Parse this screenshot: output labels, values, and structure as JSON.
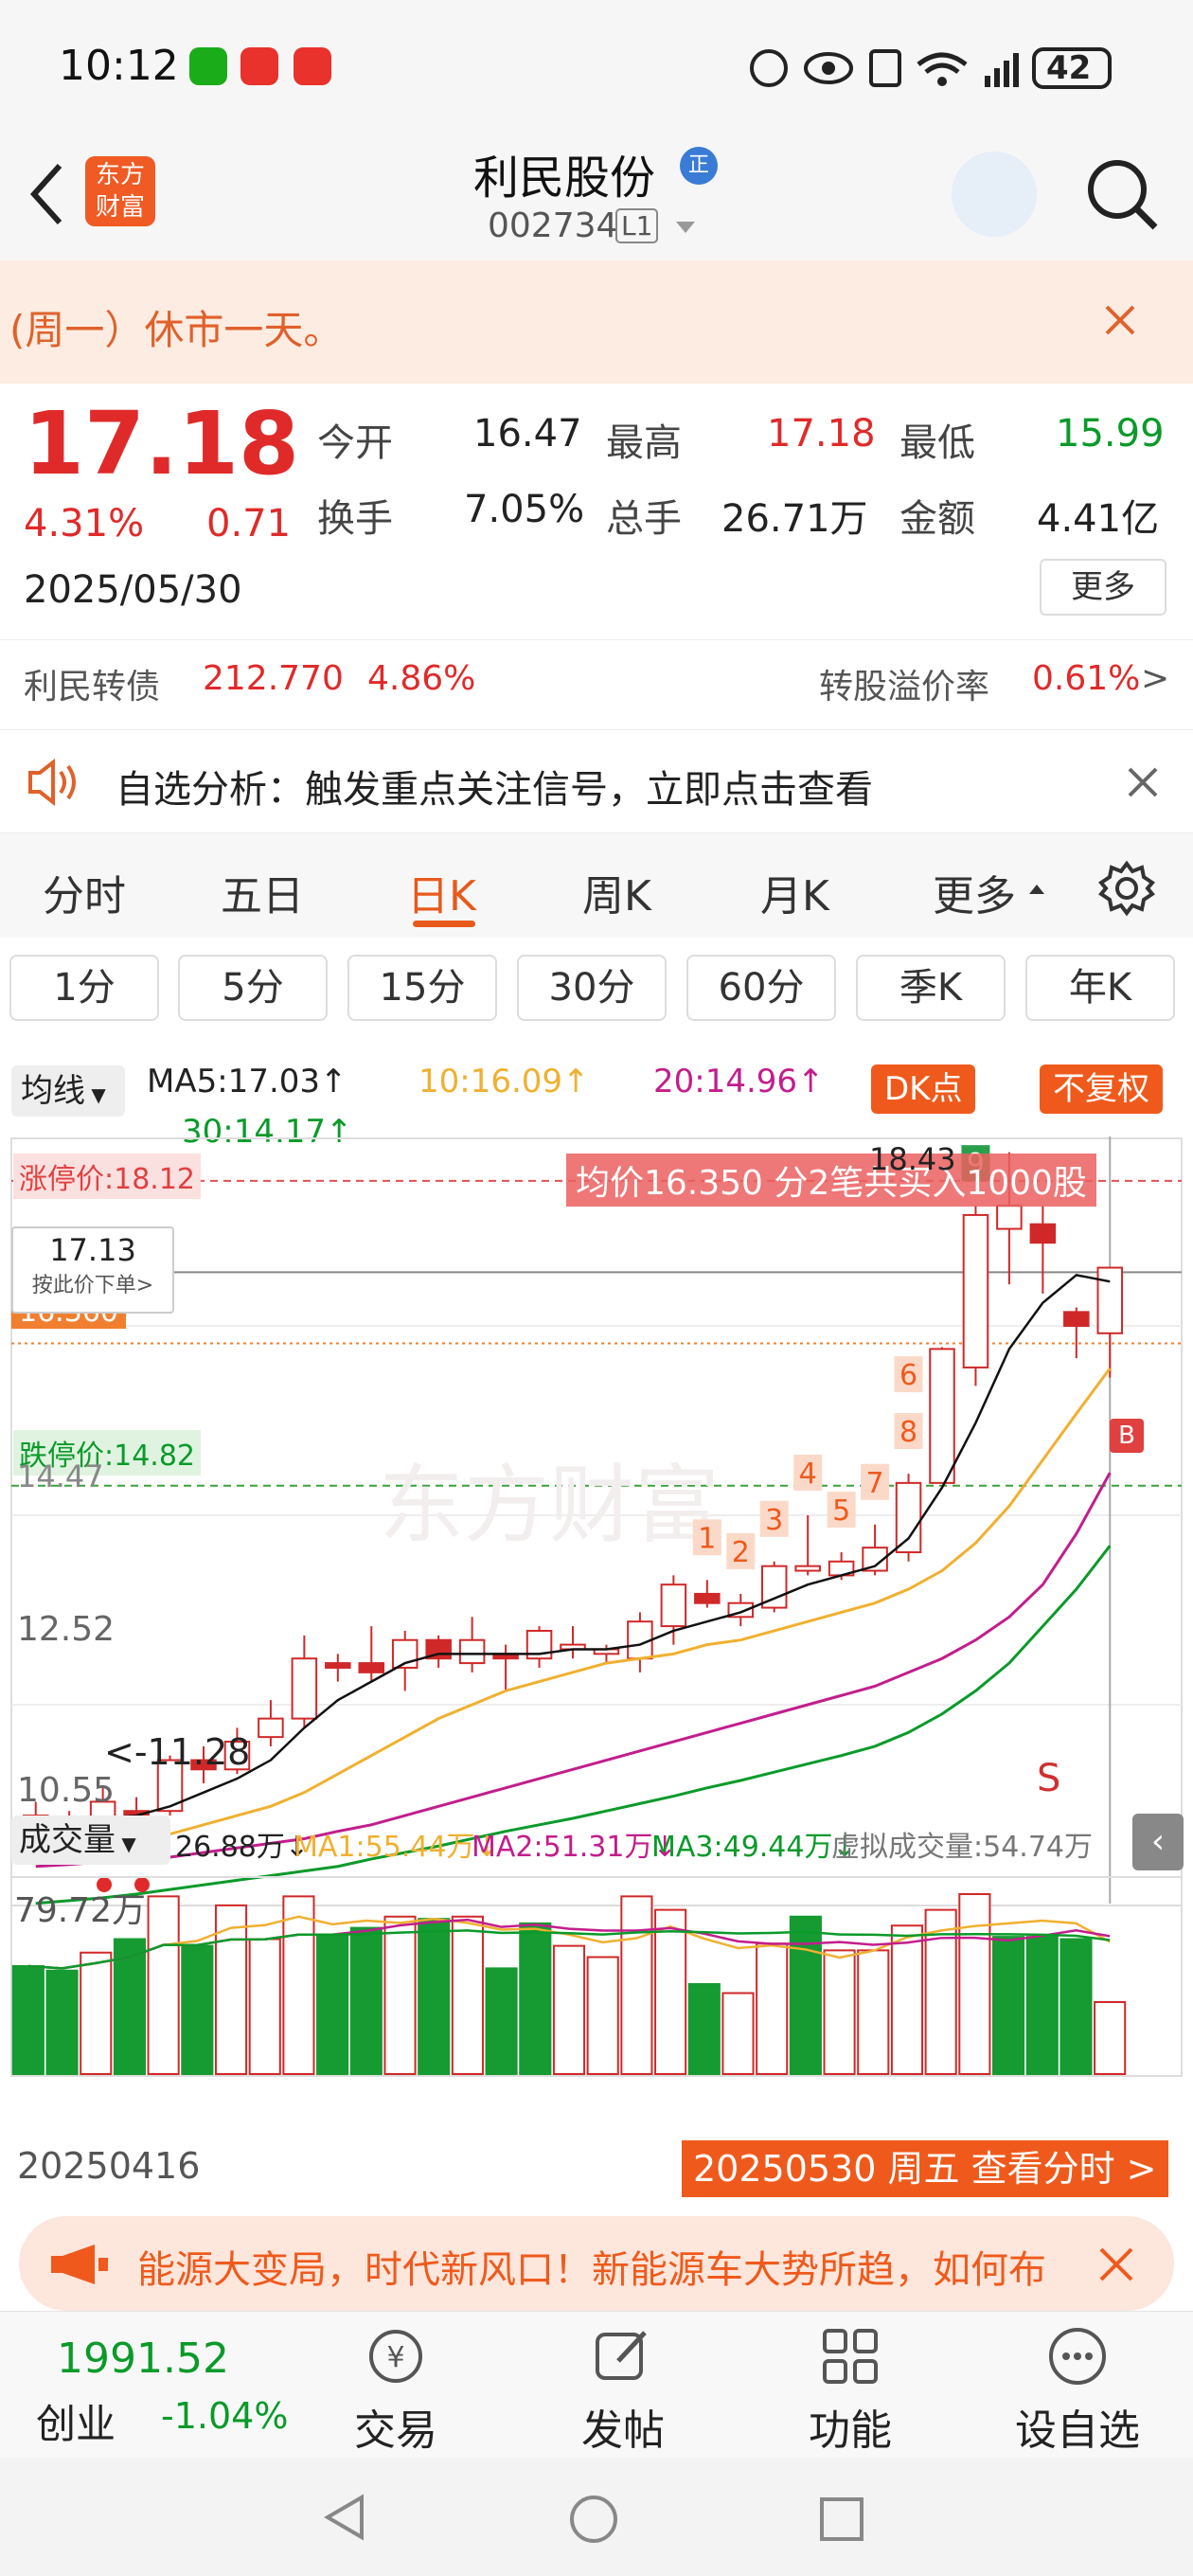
{
  "status_bar": {
    "time": "10:12",
    "battery": "42"
  },
  "header": {
    "title": "利民股份",
    "title_badge": "正",
    "code": "002734",
    "level": "L1",
    "logo_line1": "东方",
    "logo_line2": "财富"
  },
  "notice": {
    "text": "(周一）休市一天。"
  },
  "quote": {
    "price": "17.18",
    "change_pct": "4.31%",
    "change": "0.71",
    "date": "2025/05/30",
    "fields": [
      {
        "label": "今开",
        "value": "16.47"
      },
      {
        "label": "最高",
        "value": "17.18"
      },
      {
        "label": "最低",
        "value": "15.99"
      },
      {
        "label": "换手",
        "value": "7.05%"
      },
      {
        "label": "总手",
        "value": "26.71万"
      },
      {
        "label": "金额",
        "value": "4.41亿"
      }
    ],
    "more_label": "更多"
  },
  "convertible": {
    "name": "利民转债",
    "price": "212.770",
    "pct": "4.86%",
    "premium_label": "转股溢价率",
    "premium_value": "0.61%",
    "arrow": ">"
  },
  "signal": {
    "text": "自选分析：触发重点关注信号，立即点击查看"
  },
  "tabs": [
    "分时",
    "五日",
    "日K",
    "周K",
    "月K",
    "更多"
  ],
  "active_tab": "日K",
  "periods": [
    "1分",
    "5分",
    "15分",
    "30分",
    "60分",
    "季K",
    "年K"
  ],
  "ma_bar": {
    "selector": "均线",
    "ma5": "MA5:17.03↑",
    "ma10": "10:16.09↑",
    "ma20": "20:14.96↑",
    "ma30": "30:14.17↑",
    "dk_label": "DK点",
    "fq_label": "不复权"
  },
  "price_chart": {
    "limit_up_label": "涨停价:18.12",
    "limit_down_label": "跌停价:14.82",
    "high_label": "18.43",
    "low_label": "<-11.28",
    "avg_text": "均价16.350  分2笔共买入1000股",
    "cursor_price": "17.13",
    "cursor_hint": "按此价下单>",
    "left_tag": "16.360",
    "y_mid1": "14.47",
    "y_mid2": "12.52",
    "y_low": "10.55",
    "nums": [
      "1",
      "2",
      "3",
      "4",
      "5",
      "6",
      "7",
      "8",
      "9"
    ],
    "sell_marker": "S",
    "buy_marker": "B",
    "watermark": "东方财富"
  },
  "volume": {
    "selector": "成交量",
    "vol": "26.88万↓",
    "ma1": "MA1:55.44万↓",
    "ma2": "MA2:51.31万↓",
    "ma3": "MA3:49.44万↓",
    "virtual": "虚拟成交量:54.74万",
    "ymax": "79.72万"
  },
  "date_start": "20250416",
  "date_end": "20250530 周五 查看分时 >",
  "ad": {
    "text": "能源大变局，时代新风口！新能源车大势所趋，如何布"
  },
  "bottom_nav": {
    "index_value": "1991.52",
    "index_name": "创业",
    "index_pct": "-1.04%",
    "items": [
      "交易",
      "发帖",
      "功能",
      "设自选"
    ]
  },
  "chart_data": {
    "type": "candlestick",
    "candles": [
      {
        "o": 11.25,
        "c": 11.15,
        "h": 11.4,
        "l": 11.0
      },
      {
        "o": 11.1,
        "c": 11.2,
        "h": 11.3,
        "l": 10.95
      },
      {
        "o": 11.2,
        "c": 11.4,
        "h": 11.55,
        "l": 11.1
      },
      {
        "o": 11.3,
        "c": 11.2,
        "h": 11.45,
        "l": 11.05
      },
      {
        "o": 11.3,
        "c": 11.85,
        "h": 11.9,
        "l": 11.25
      },
      {
        "o": 11.85,
        "c": 11.75,
        "h": 12.0,
        "l": 11.6
      },
      {
        "o": 11.75,
        "c": 12.05,
        "h": 12.2,
        "l": 11.7
      },
      {
        "o": 12.1,
        "c": 12.3,
        "h": 12.5,
        "l": 12.0
      },
      {
        "o": 12.3,
        "c": 12.95,
        "h": 13.2,
        "l": 12.2
      },
      {
        "o": 12.9,
        "c": 12.85,
        "h": 13.0,
        "l": 12.7
      },
      {
        "o": 12.9,
        "c": 12.8,
        "h": 13.3,
        "l": 12.7
      },
      {
        "o": 12.85,
        "c": 13.15,
        "h": 13.25,
        "l": 12.6
      },
      {
        "o": 13.15,
        "c": 12.95,
        "h": 13.2,
        "l": 12.85
      },
      {
        "o": 12.9,
        "c": 13.15,
        "h": 13.4,
        "l": 12.8
      },
      {
        "o": 13.0,
        "c": 12.95,
        "h": 13.1,
        "l": 12.6
      },
      {
        "o": 12.95,
        "c": 13.25,
        "h": 13.3,
        "l": 12.85
      },
      {
        "o": 13.05,
        "c": 13.1,
        "h": 13.3,
        "l": 12.95
      },
      {
        "o": 13.0,
        "c": 13.05,
        "h": 13.1,
        "l": 12.9
      },
      {
        "o": 12.95,
        "c": 13.35,
        "h": 13.45,
        "l": 12.8
      },
      {
        "o": 13.3,
        "c": 13.75,
        "h": 13.85,
        "l": 13.1
      },
      {
        "o": 13.65,
        "c": 13.55,
        "h": 13.8,
        "l": 13.5
      },
      {
        "o": 13.4,
        "c": 13.55,
        "h": 13.65,
        "l": 13.3
      },
      {
        "o": 13.5,
        "c": 13.95,
        "h": 14.0,
        "l": 13.45
      },
      {
        "o": 13.9,
        "c": 13.95,
        "h": 14.5,
        "l": 13.85
      },
      {
        "o": 13.85,
        "c": 14.0,
        "h": 14.1,
        "l": 13.8
      },
      {
        "o": 13.9,
        "c": 14.15,
        "h": 14.4,
        "l": 13.85
      },
      {
        "o": 14.1,
        "c": 14.85,
        "h": 14.95,
        "l": 14.0
      },
      {
        "o": 14.85,
        "c": 16.3,
        "h": 16.32,
        "l": 14.9
      },
      {
        "o": 16.1,
        "c": 17.75,
        "h": 17.85,
        "l": 15.9
      },
      {
        "o": 17.6,
        "c": 17.85,
        "h": 18.43,
        "l": 17.0
      },
      {
        "o": 17.65,
        "c": 17.45,
        "h": 17.85,
        "l": 16.9
      },
      {
        "o": 16.7,
        "c": 16.55,
        "h": 16.75,
        "l": 16.2
      },
      {
        "o": 16.47,
        "c": 17.18,
        "h": 17.18,
        "l": 15.99
      }
    ],
    "ma5": [
      11.2,
      11.2,
      11.22,
      11.25,
      11.35,
      11.5,
      11.65,
      11.85,
      12.2,
      12.5,
      12.7,
      12.9,
      13.0,
      13.0,
      13.0,
      13.0,
      13.05,
      13.05,
      13.1,
      13.25,
      13.35,
      13.45,
      13.6,
      13.75,
      13.85,
      13.95,
      14.25,
      14.8,
      15.5,
      16.3,
      16.8,
      17.1,
      17.03
    ],
    "ma10": [
      10.85,
      10.9,
      10.95,
      11.0,
      11.05,
      11.15,
      11.25,
      11.35,
      11.5,
      11.7,
      11.9,
      12.1,
      12.3,
      12.45,
      12.6,
      12.7,
      12.8,
      12.9,
      12.95,
      13.0,
      13.1,
      13.15,
      13.25,
      13.35,
      13.45,
      13.55,
      13.7,
      13.9,
      14.2,
      14.6,
      15.1,
      15.6,
      16.09
    ],
    "ma20": [
      10.7,
      10.72,
      10.75,
      10.78,
      10.8,
      10.85,
      10.9,
      10.95,
      11.0,
      11.08,
      11.15,
      11.25,
      11.35,
      11.45,
      11.55,
      11.65,
      11.75,
      11.85,
      11.95,
      12.05,
      12.15,
      12.25,
      12.35,
      12.45,
      12.55,
      12.65,
      12.8,
      12.95,
      13.15,
      13.4,
      13.75,
      14.3,
      14.96
    ],
    "ma30": [
      10.3,
      10.33,
      10.36,
      10.4,
      10.45,
      10.5,
      10.55,
      10.6,
      10.65,
      10.7,
      10.78,
      10.85,
      10.92,
      11.0,
      11.08,
      11.15,
      11.22,
      11.3,
      11.38,
      11.46,
      11.55,
      11.63,
      11.72,
      11.81,
      11.9,
      12.0,
      12.15,
      12.35,
      12.6,
      12.9,
      13.3,
      13.7,
      14.17
    ],
    "volumes": [
      48,
      46,
      54,
      60,
      79,
      57,
      75,
      60,
      79,
      62,
      65,
      70,
      69,
      70,
      47,
      67,
      57,
      52,
      79,
      73,
      40,
      36,
      58,
      70,
      55,
      55,
      66,
      73,
      80,
      61,
      61,
      60,
      32
    ],
    "vol_up": [
      false,
      false,
      true,
      false,
      true,
      false,
      true,
      true,
      true,
      false,
      false,
      true,
      false,
      true,
      false,
      false,
      true,
      true,
      true,
      true,
      false,
      true,
      true,
      false,
      true,
      true,
      true,
      true,
      true,
      false,
      false,
      false,
      true
    ],
    "y_range": [
      10.4,
      18.6
    ]
  }
}
